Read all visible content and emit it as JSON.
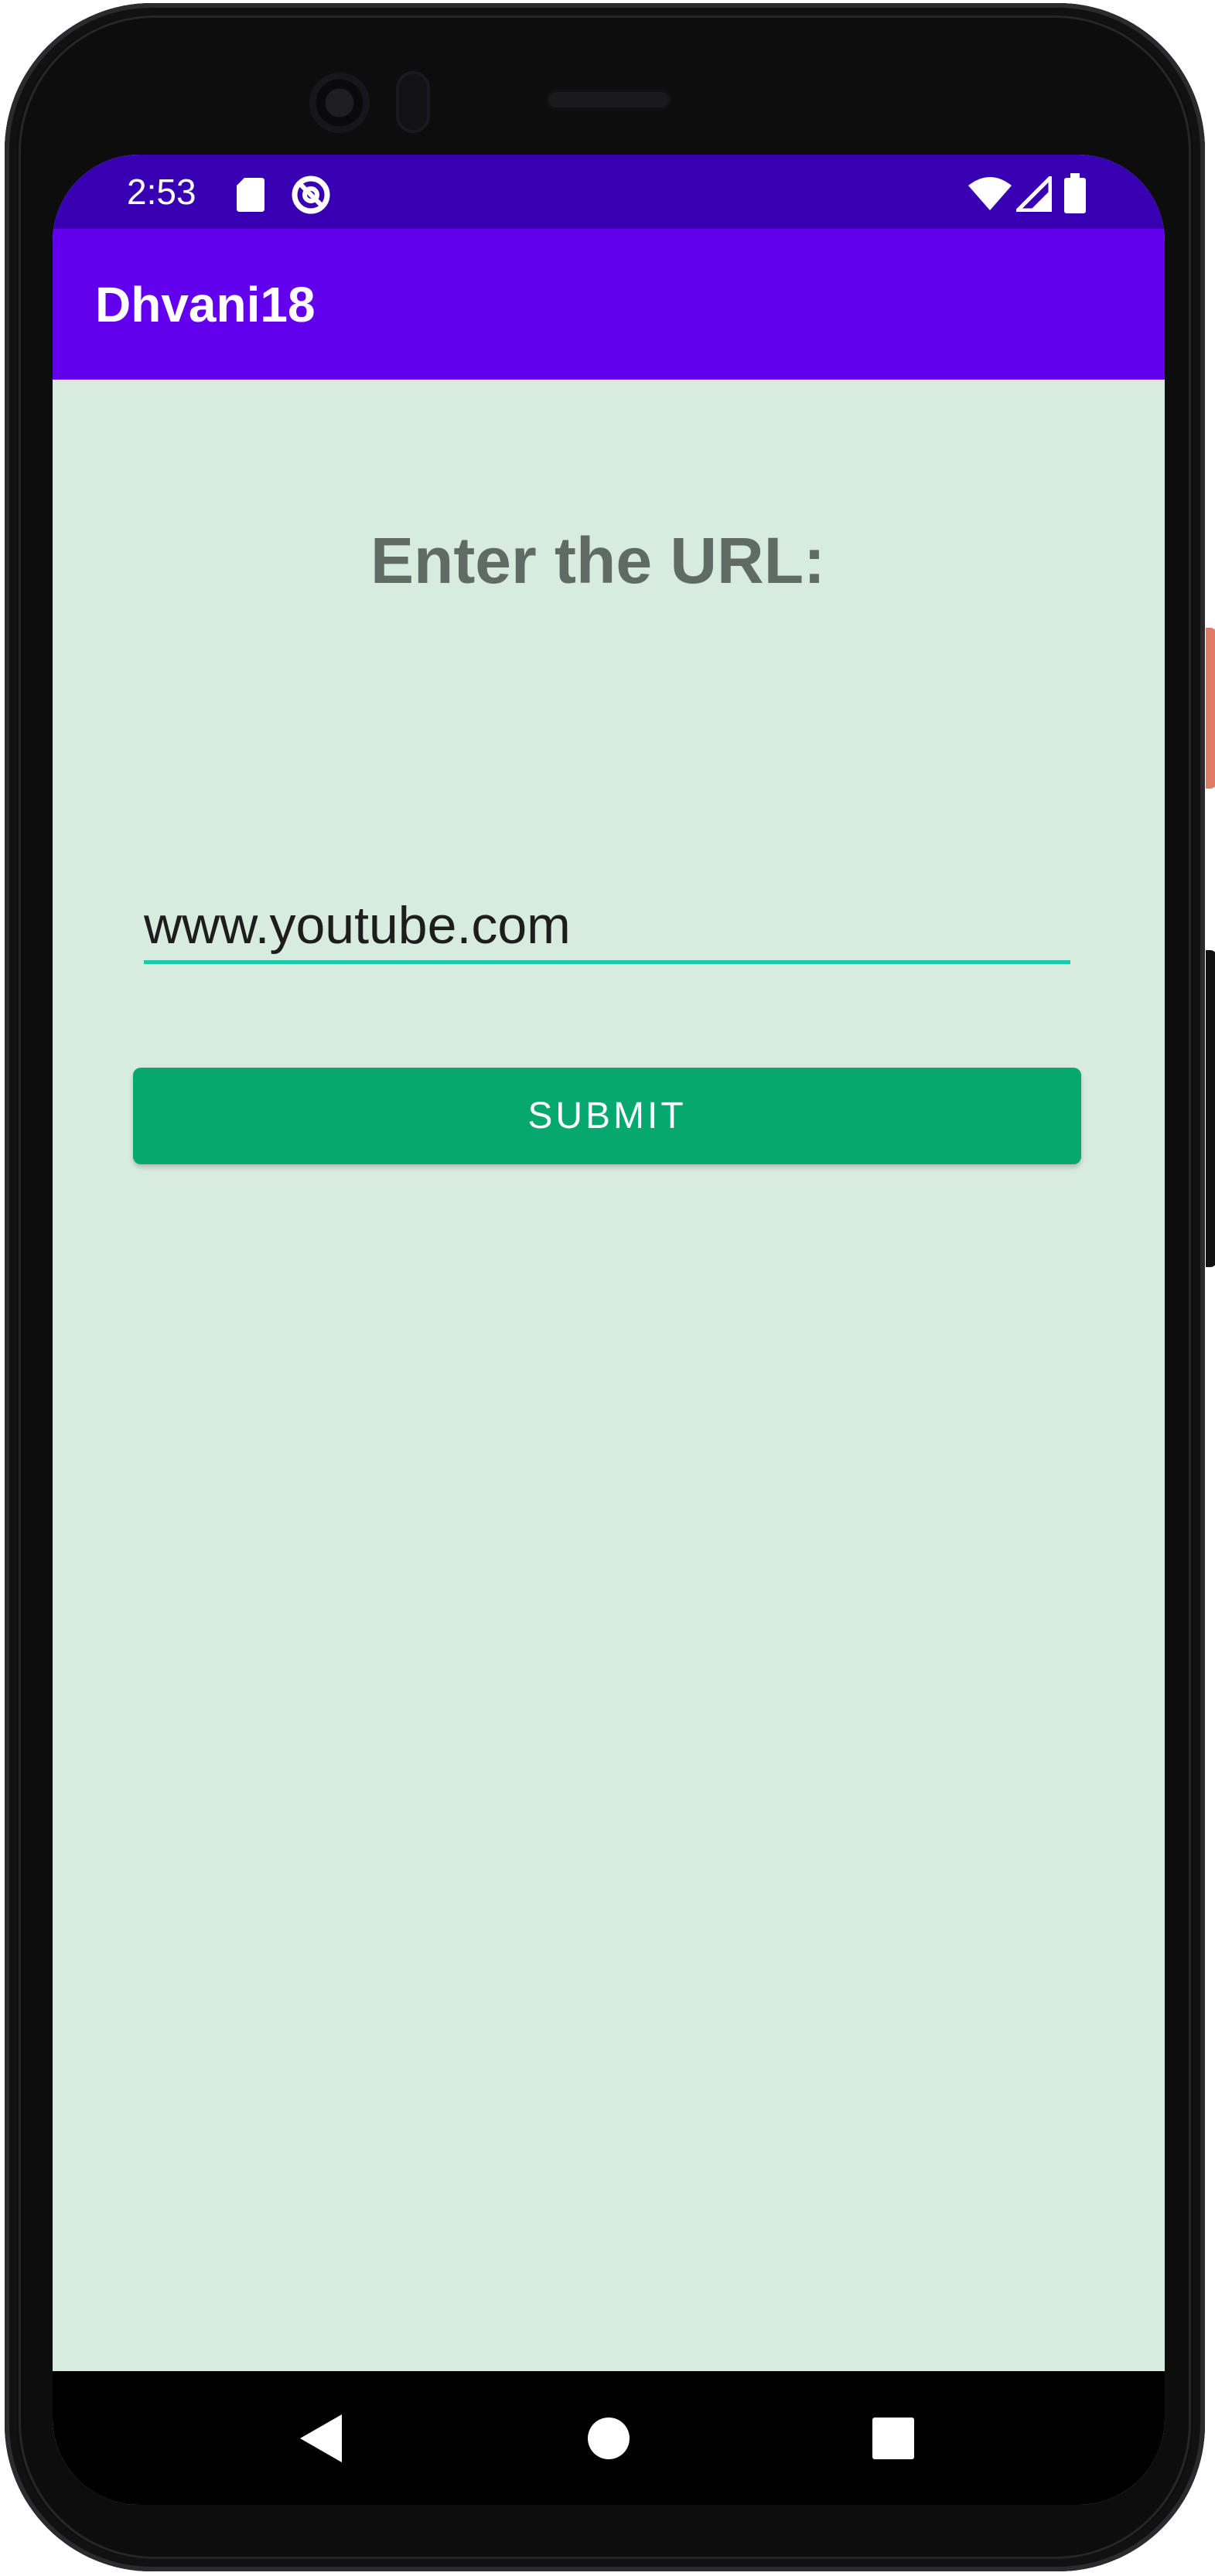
{
  "status_bar": {
    "time": "2:53",
    "icons": [
      "sd-card-icon",
      "sync-icon",
      "wifi-icon",
      "signal-icon",
      "battery-icon"
    ]
  },
  "app_bar": {
    "title": "Dhvani18"
  },
  "main": {
    "heading": "Enter the URL:",
    "url_input": {
      "value": "www.youtube.com"
    },
    "submit_label": "SUBMIT"
  },
  "navigation": {
    "buttons": [
      "back-icon",
      "home-icon",
      "recents-icon"
    ]
  },
  "colors": {
    "status_bar": "#3700b3",
    "app_bar": "#6200ee",
    "background": "#d7ebdf",
    "heading": "#5f6b64",
    "input_underline": "#18c9ad",
    "button": "#05a86e",
    "button_text": "#ffffff"
  }
}
